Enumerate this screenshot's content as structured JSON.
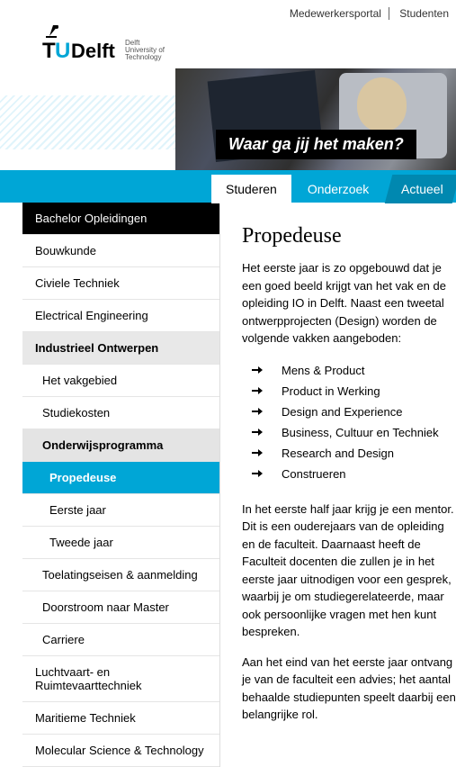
{
  "topLinks": {
    "medewerkers": "Medewerkersportal",
    "studenten": "Studenten"
  },
  "logo": {
    "tu": "TU",
    "delft": "Delft",
    "sub1": "Delft",
    "sub2": "University of",
    "sub3": "Technology"
  },
  "hero": {
    "caption": "Waar ga jij het maken?"
  },
  "nav": {
    "studeren": "Studeren",
    "onderzoek": "Onderzoek",
    "actueel": "Actueel"
  },
  "sidebar": {
    "header": "Bachelor Opleidingen",
    "items": [
      "Bouwkunde",
      "Civiele Techniek",
      "Electrical Engineering",
      "Industrieel Ontwerpen",
      "Luchtvaart- en Ruimtevaarttechniek",
      "Maritieme Techniek",
      "Molecular Science & Technology"
    ],
    "sub": {
      "vakgebied": "Het vakgebied",
      "studiekosten": "Studiekosten",
      "onderwijs": "Onderwijsprogramma",
      "propedeuse": "Propedeuse",
      "eerste": "Eerste jaar",
      "tweede": "Tweede jaar",
      "toelatings": "Toelatingseisen & aanmelding",
      "doorstroom": "Doorstroom naar Master",
      "carriere": "Carriere"
    }
  },
  "main": {
    "title": "Propedeuse",
    "intro": "Het eerste jaar is zo opgebouwd dat je een goed beeld krijgt van het vak en de opleiding IO in Delft. Naast een tweetal ontwerpprojecten (Design) worden de volgende vakken aangeboden:",
    "courses": [
      "Mens & Product",
      "Product in Werking",
      "Design and Experience",
      "Business, Cultuur en Techniek",
      "Research and Design",
      "Construeren"
    ],
    "para2": "In het eerste half jaar krijg je een mentor. Dit is een ouderejaars van de opleiding en de faculteit. Daarnaast heeft de Faculteit docenten die zullen je in het eerste jaar uitnodigen voor een gesprek, waarbij je om studiegerelateerde, maar ook persoonlijke vragen met hen kunt bespreken.",
    "para3": "Aan het eind van het eerste jaar ontvang je van de faculteit een advies; het aantal behaalde studiepunten speelt daarbij een belangrijke rol."
  }
}
